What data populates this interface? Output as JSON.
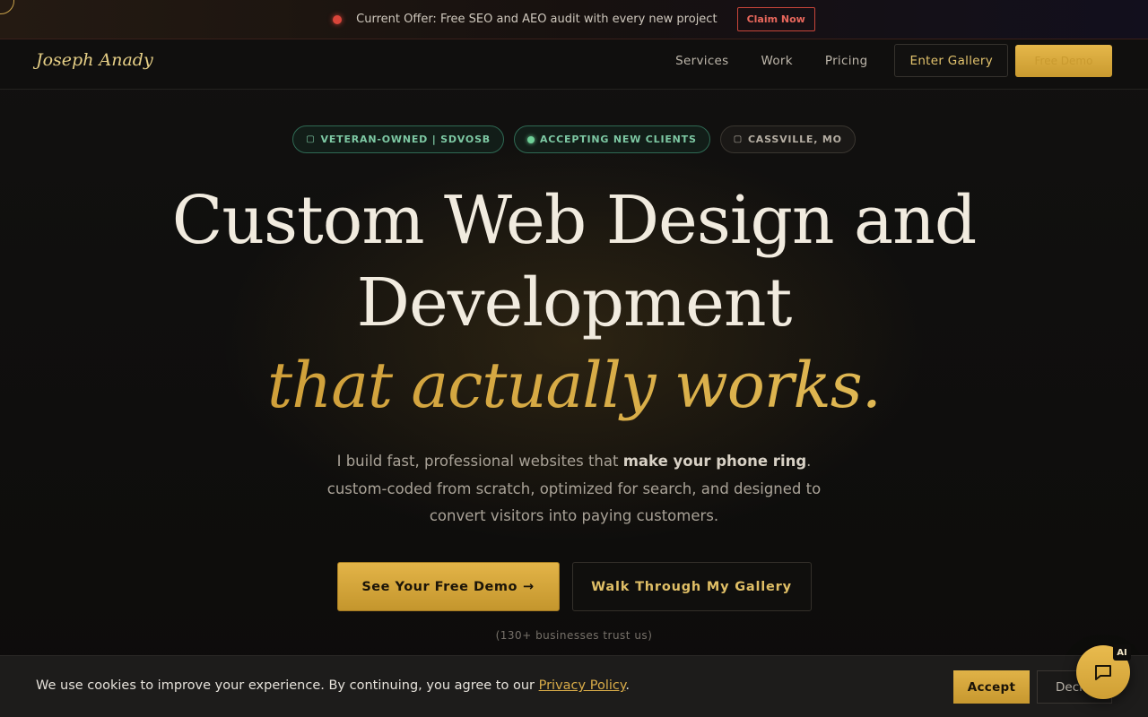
{
  "offer_bar": {
    "text": "Current Offer: Free SEO and AEO audit with every new project",
    "claim_label": "Claim Now"
  },
  "nav": {
    "logo": "Joseph Anady",
    "links": [
      "Services",
      "Work",
      "Pricing"
    ],
    "enter_gallery_label": "Enter Gallery",
    "free_demo_label": "Free Demo"
  },
  "badges": [
    {
      "icon": "shield-icon",
      "label": "VETERAN-OWNED | SDVOSB"
    },
    {
      "icon": "live-dot",
      "label": "ACCEPTING NEW CLIENTS"
    },
    {
      "icon": "location-pin-icon",
      "label": "CASSVILLE, MO"
    }
  ],
  "hero": {
    "title_line1": "Custom Web Design and",
    "title_line2": "Development",
    "accent": "that actually works.",
    "subtitle_pre": "I build fast, professional websites that ",
    "subtitle_bold": "make your phone ring",
    "subtitle_post": ". custom-coded from scratch, optimized for search, and designed to convert visitors into paying customers."
  },
  "cta": {
    "primary_label": "See Your Free Demo",
    "primary_arrow": "→",
    "secondary_label": "Walk Through My Gallery"
  },
  "trust_text": "(130+ businesses trust us)",
  "cookie": {
    "text_pre": "We use cookies to improve your experience. By continuing, you agree to our ",
    "link_label": "Privacy Policy",
    "text_post": ".",
    "accept_label": "Accept",
    "decline_label": "Decline"
  },
  "chat": {
    "ai_label": "AI",
    "icon": "chat-bubble-icon"
  },
  "colors": {
    "accent_gold": "#d8a93e",
    "offer_dot": "#d9453a",
    "badge_green": "#7dc8a3",
    "background": "#0c0b0a"
  }
}
